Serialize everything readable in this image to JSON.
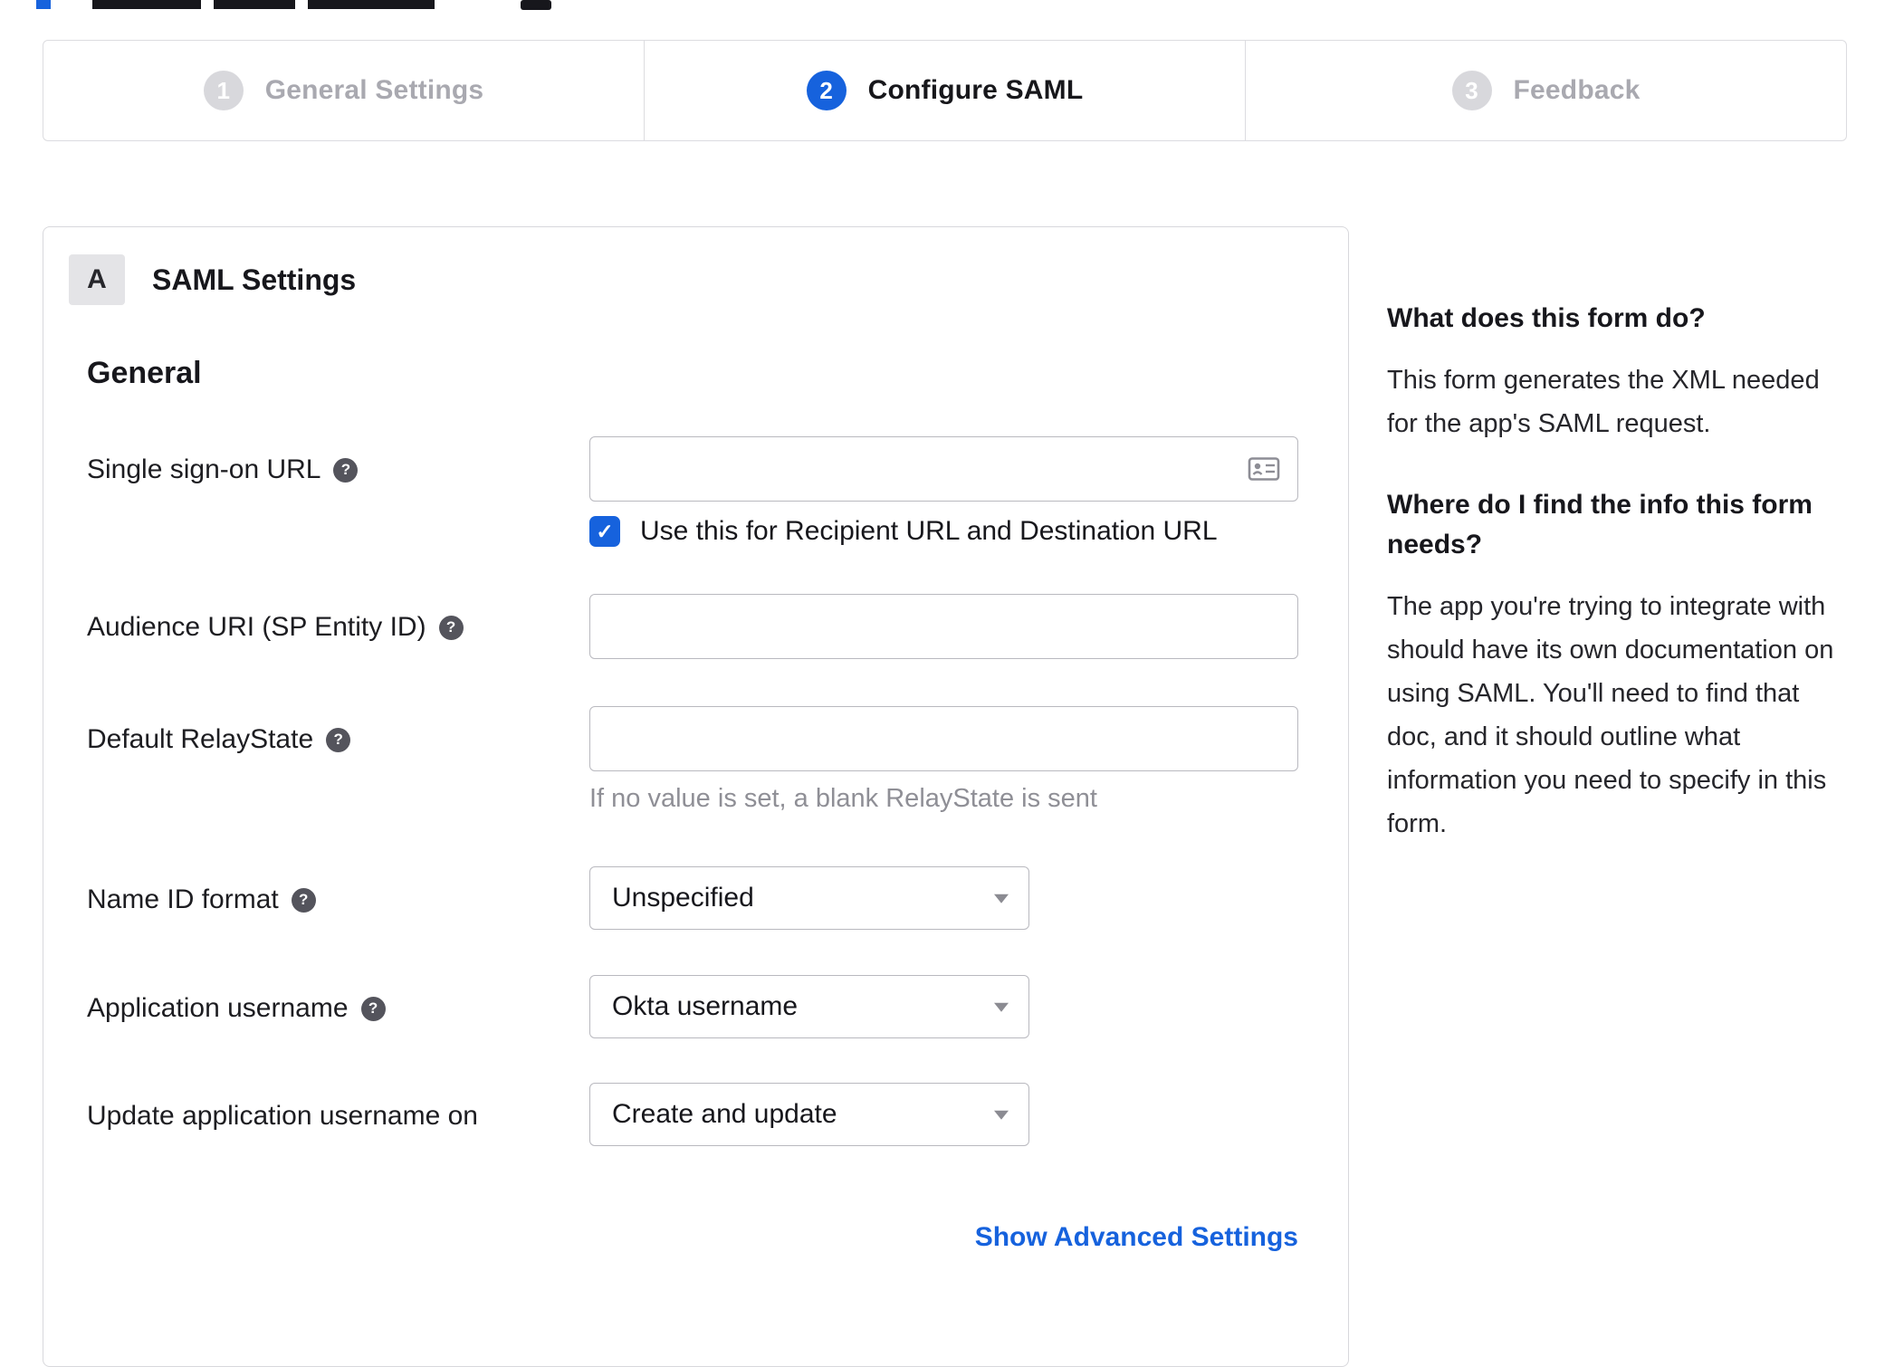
{
  "stepper": {
    "steps": [
      {
        "number": "1",
        "label": "General Settings",
        "state": "inactive"
      },
      {
        "number": "2",
        "label": "Configure SAML",
        "state": "active"
      },
      {
        "number": "3",
        "label": "Feedback",
        "state": "inactive"
      }
    ]
  },
  "panel": {
    "badge": "A",
    "title": "SAML Settings",
    "section_title": "General",
    "sso_label": "Single sign-on URL",
    "sso_value": "",
    "sso_checkbox_label": "Use this for Recipient URL and Destination URL",
    "sso_checkbox_checked": true,
    "audience_label": "Audience URI (SP Entity ID)",
    "audience_value": "",
    "relay_label": "Default RelayState",
    "relay_value": "",
    "relay_hint": "If no value is set, a blank RelayState is sent",
    "nameid_label": "Name ID format",
    "nameid_value": "Unspecified",
    "appuser_label": "Application username",
    "appuser_value": "Okta username",
    "updateuser_label": "Update application username on",
    "updateuser_value": "Create and update",
    "advanced_link": "Show Advanced Settings"
  },
  "help_panel": {
    "heading1": "What does this form do?",
    "body1": "This form generates the XML needed for the app's SAML request.",
    "heading2": "Where do I find the info this form needs?",
    "body2": "The app you're trying to integrate with should have its own documentation on using SAML. You'll need to find that doc, and it should outline what information you need to specify in this form."
  },
  "icons": {
    "help": "?",
    "check": "✓",
    "sso_field_icon": "contact-card-icon"
  },
  "colors": {
    "accent": "#1662dd",
    "inactive_step": "#d8d8dc",
    "border": "#d8d8dc",
    "link": "#1662dd"
  }
}
